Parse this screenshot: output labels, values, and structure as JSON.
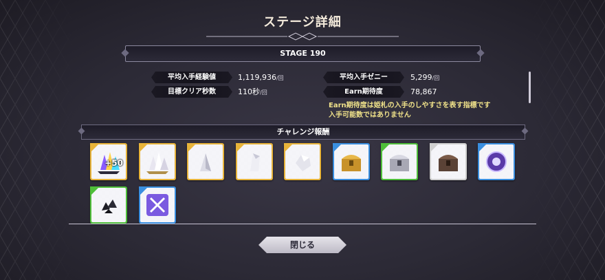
{
  "title": "ステージ詳細",
  "stage": "STAGE 190",
  "stats": {
    "avg_exp_label": "平均入手経験値",
    "avg_exp_value": "1,119,936",
    "avg_exp_unit": "/回",
    "avg_zeny_label": "平均入手ゼニー",
    "avg_zeny_value": "5,299",
    "avg_zeny_unit": "/回",
    "clear_sec_label": "目標クリア秒数",
    "clear_sec_value": "110秒",
    "clear_sec_unit": "/回",
    "earn_label": "Earn期待度",
    "earn_value": "78,867"
  },
  "note_line1": "Earn期待度は姫札の入手のしやすさを表す指標です",
  "note_line2": "入手可能数ではありません",
  "challenge_label": "チャレンジ報酬",
  "items": [
    {
      "name": "rainbow-crystal-cluster-icon",
      "rarity": "#e8b43a",
      "badge": "+50"
    },
    {
      "name": "white-crystal-cluster-icon",
      "rarity": "#e8b43a",
      "badge": ""
    },
    {
      "name": "silver-crystal-icon",
      "rarity": "#e8b43a",
      "badge": ""
    },
    {
      "name": "white-crystal-shard-icon",
      "rarity": "#e8b43a",
      "badge": ""
    },
    {
      "name": "white-stone-icon",
      "rarity": "#e8b43a",
      "badge": ""
    },
    {
      "name": "gold-treasure-chest-icon",
      "rarity": "#3a8fe0",
      "badge": ""
    },
    {
      "name": "silver-treasure-chest-icon",
      "rarity": "#4fbf3a",
      "badge": ""
    },
    {
      "name": "bronze-treasure-chest-icon",
      "rarity": "#d0d0d0",
      "badge": ""
    },
    {
      "name": "purple-emblem-icon",
      "rarity": "#3a8fe0",
      "badge": ""
    },
    {
      "name": "black-shards-icon",
      "rarity": "#4fbf3a",
      "badge": ""
    },
    {
      "name": "crossed-swords-ticket-icon",
      "rarity": "#3a8fe0",
      "badge": ""
    }
  ],
  "close_label": "閉じる"
}
